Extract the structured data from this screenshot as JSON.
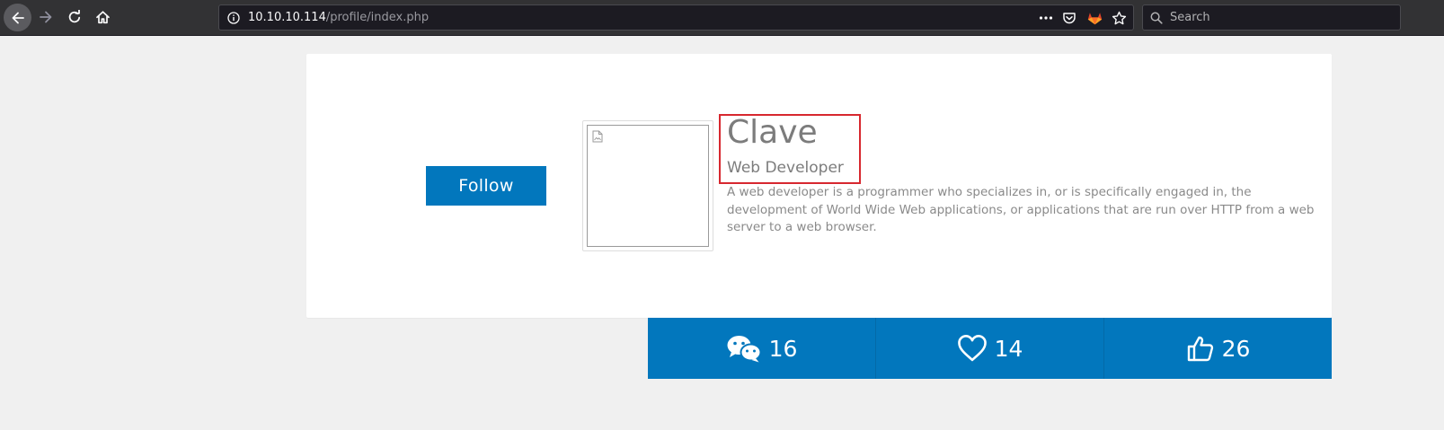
{
  "browser": {
    "url_host": "10.10.10.114",
    "url_path": "/profile/index.php",
    "search_placeholder": "Search",
    "icons": [
      "back-arrow-icon",
      "forward-arrow-icon",
      "reload-icon",
      "home-icon",
      "info-icon",
      "more-dots-icon",
      "pocket-icon",
      "gitlab-icon",
      "star-icon",
      "search-icon"
    ]
  },
  "profile": {
    "follow_label": "Follow",
    "name": "Clave",
    "role": "Web Developer",
    "bio": "A web developer is a programmer who specializes in, or is specifically engaged in, the development of World Wide Web applications, or applications that are run over HTTP from a web server to a web browser.",
    "highlight_color": "#d7282f"
  },
  "stats": [
    {
      "icon": "chat-bubbles-icon",
      "value": "16"
    },
    {
      "icon": "heart-icon",
      "value": "14"
    },
    {
      "icon": "thumbs-up-icon",
      "value": "26"
    }
  ],
  "colors": {
    "accent": "#0277bd",
    "page_background": "#f0f0f0",
    "toolbar": "#323234"
  }
}
